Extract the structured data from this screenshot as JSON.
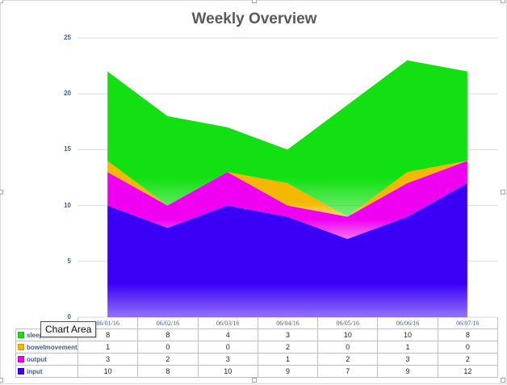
{
  "chart_data": {
    "type": "area",
    "stacked": true,
    "title": "Weekly Overview",
    "categories": [
      "06/01/16",
      "06/02/16",
      "06/03/16",
      "06/04/16",
      "06/05/16",
      "06/06/16",
      "06/07/16"
    ],
    "ylim": [
      0,
      25
    ],
    "yticks": [
      0,
      5,
      10,
      15,
      20,
      25
    ],
    "grid": true,
    "legend": "data-table",
    "series": [
      {
        "name": "input",
        "color": "#3a00f5",
        "values": [
          10,
          8,
          10,
          9,
          7,
          9,
          12
        ]
      },
      {
        "name": "output",
        "color": "#f000f0",
        "values": [
          3,
          2,
          3,
          1,
          2,
          3,
          2
        ]
      },
      {
        "name": "bowelmovement",
        "color": "#f5b800",
        "values": [
          1,
          0,
          0,
          2,
          0,
          1,
          0
        ]
      },
      {
        "name": "sleep",
        "color": "#12e012",
        "values": [
          8,
          8,
          4,
          3,
          10,
          10,
          8
        ]
      }
    ]
  },
  "tooltip": "Chart Area"
}
